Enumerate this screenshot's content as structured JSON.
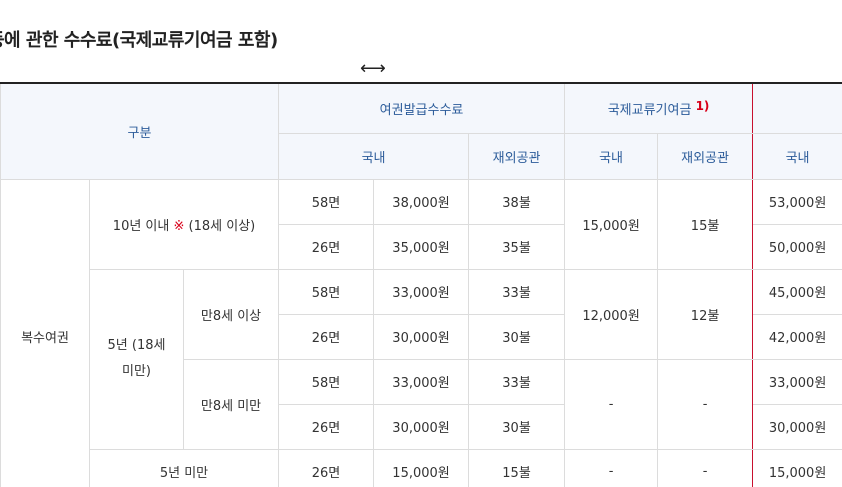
{
  "page": {
    "title": "등에 관한 수수료(국제교류기여금 포함)",
    "scroll_hint_icon": "horizontal-scroll-icon",
    "scroll_hint_glyph": "⟷"
  },
  "table": {
    "headers": {
      "category": "구분",
      "issuance_fee": "여권발급수수료",
      "contribution": "국제교류기여금",
      "contribution_note": "1)",
      "domestic": "국내",
      "overseas": "재외공관",
      "domestic2": "국내",
      "overseas2": "재외공관",
      "domestic3": "국내"
    },
    "groups": {
      "multi_passport": "복수여권",
      "ten_years_prefix": "10년 이내 ",
      "ten_years_mark": "※",
      "ten_years_suffix": " (18세 이상)",
      "five_years": "5년 (18세 미만)",
      "age8_over": "만8세 이상",
      "age8_under": "만8세 미만",
      "under_five": "5년 미만"
    },
    "rows": [
      {
        "pages": "58면",
        "domestic": "38,000원",
        "overseas": "38불",
        "total_domestic": "53,000원"
      },
      {
        "pages": "26면",
        "domestic": "35,000원",
        "overseas": "35불",
        "total_domestic": "50,000원"
      },
      {
        "pages": "58면",
        "domestic": "33,000원",
        "overseas": "33불",
        "total_domestic": "45,000원"
      },
      {
        "pages": "26면",
        "domestic": "30,000원",
        "overseas": "30불",
        "total_domestic": "42,000원"
      },
      {
        "pages": "58면",
        "domestic": "33,000원",
        "overseas": "33불",
        "total_domestic": "33,000원"
      },
      {
        "pages": "26면",
        "domestic": "30,000원",
        "overseas": "30불",
        "total_domestic": "30,000원"
      },
      {
        "pages": "26면",
        "domestic": "15,000원",
        "overseas": "15불",
        "total_domestic": "15,000원"
      }
    ],
    "contributions": [
      {
        "domestic": "15,000원",
        "overseas": "15불"
      },
      {
        "domestic": "12,000원",
        "overseas": "12불"
      },
      {
        "domestic": "-",
        "overseas": "-"
      },
      {
        "domestic": "-",
        "overseas": "-"
      }
    ]
  }
}
